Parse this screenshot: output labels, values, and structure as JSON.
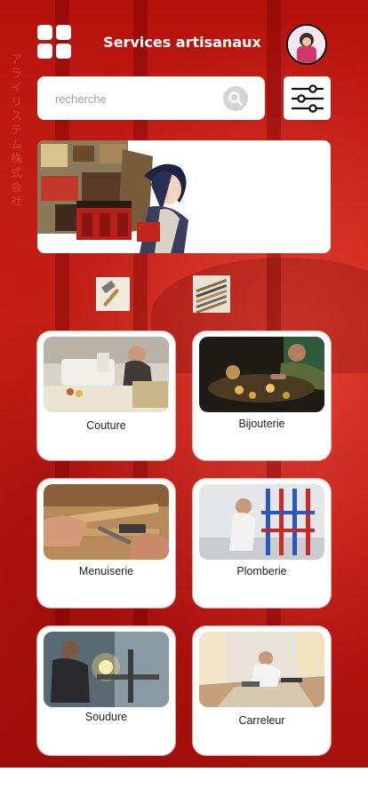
{
  "header": {
    "title": "Services artisanaux",
    "menu_icon": "grid-menu-icon",
    "avatar_icon": "user-avatar"
  },
  "search": {
    "placeholder": "recherche",
    "icon": "search-icon"
  },
  "filter": {
    "icon": "sliders-filter-icon"
  },
  "banner": {
    "icon": "artisan-illustration"
  },
  "categories_icons": [
    "hammer-icon",
    "tools-icon"
  ],
  "services": [
    {
      "label": "Couture",
      "icon": "sewing-photo"
    },
    {
      "label": "Bijouterie",
      "icon": "jewelry-photo"
    },
    {
      "label": "Menuiserie",
      "icon": "carpentry-photo"
    },
    {
      "label": "Plomberie",
      "icon": "plumbing-photo"
    },
    {
      "label": "Soudure",
      "icon": "welding-photo"
    },
    {
      "label": "Carreleur",
      "icon": "tiling-photo"
    }
  ],
  "colors": {
    "background": "#c8180f",
    "card": "#ffffff",
    "text_light": "#ffffff",
    "text_dark": "#222222"
  }
}
